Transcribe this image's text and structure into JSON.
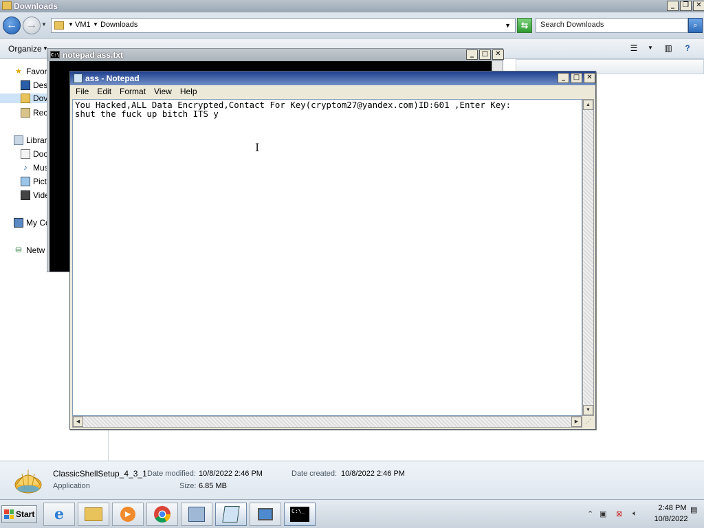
{
  "explorer": {
    "title": "Downloads",
    "address": {
      "crumbs": [
        "VM1",
        "Downloads"
      ]
    },
    "search_placeholder": "Search Downloads",
    "toolbar": {
      "organize_label": "Organize"
    },
    "nav": [
      {
        "label": "Favor",
        "icon": "star-icon"
      },
      {
        "label": "Des",
        "icon": "desktop-icon"
      },
      {
        "label": "Dov",
        "icon": "downloads-folder-icon"
      },
      {
        "label": "Rec",
        "icon": "recent-places-icon"
      },
      {
        "label": "Librar",
        "icon": "libraries-icon"
      },
      {
        "label": "Doc",
        "icon": "documents-icon"
      },
      {
        "label": "Mus",
        "icon": "music-icon"
      },
      {
        "label": "Pict",
        "icon": "pictures-icon"
      },
      {
        "label": "Vide",
        "icon": "videos-icon"
      },
      {
        "label": "My Co",
        "icon": "computer-icon"
      },
      {
        "label": "Netw",
        "icon": "network-icon"
      }
    ],
    "details": {
      "name": "ClassicShellSetup_4_3_1",
      "type": "Application",
      "date_modified_label": "Date modified:",
      "date_modified": "10/8/2022 2:46 PM",
      "date_created_label": "Date created:",
      "date_created": "10/8/2022 2:46 PM",
      "size_label": "Size:",
      "size": "6.85 MB"
    }
  },
  "console": {
    "title": "notepad  ass.txt"
  },
  "notepad": {
    "title": "ass - Notepad",
    "menu": [
      "File",
      "Edit",
      "Format",
      "View",
      "Help"
    ],
    "content": "You Hacked,ALL Data Encrypted,Contact For Key(cryptom27@yandex.com)ID:601 ,Enter Key:\nshut the fuck up bitch ITS y"
  },
  "taskbar": {
    "start_label": "Start",
    "clock_time": "2:48 PM",
    "clock_date": "10/8/2022"
  },
  "colors": {
    "notepad_title_start": "#1e3f8f",
    "notepad_title_end": "#7391c7",
    "console_bg": "#000000",
    "taskbar_bg": "#dbe3ec"
  }
}
